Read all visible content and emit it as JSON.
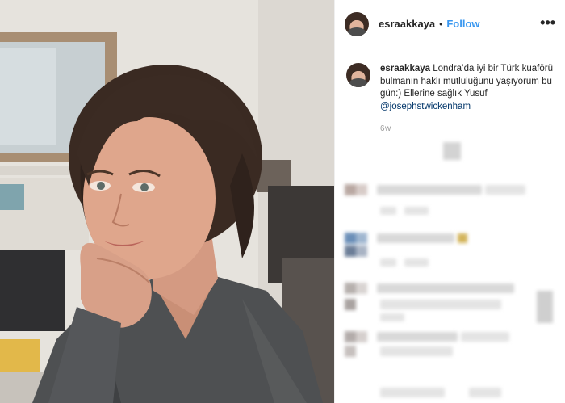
{
  "post": {
    "username": "esraakkaya",
    "separator": "•",
    "follow_label": "Follow",
    "more_label": "•••"
  },
  "caption": {
    "username": "esraakkaya",
    "text": " Londra’da iyi bir Türk kuaförü bulmanın haklı mutluluğunu yaşıyorum bu gün:) Ellerine sağlık Yusuf ",
    "mention": "@josephstwickenham",
    "time": "6w"
  },
  "colors": {
    "link": "#3897f0",
    "mention": "#003569",
    "text": "#262626",
    "muted": "#999999"
  }
}
